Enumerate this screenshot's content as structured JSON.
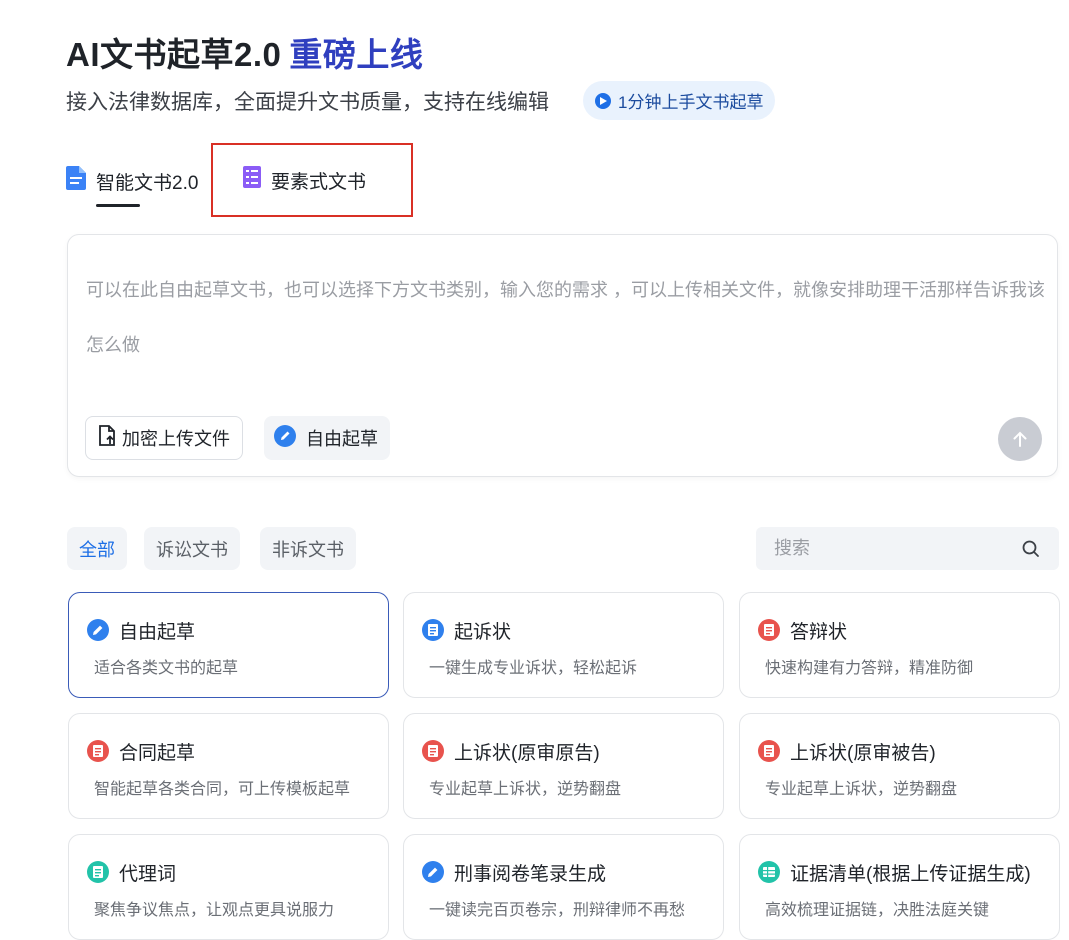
{
  "header": {
    "title": "AI文书起草2.0",
    "title_accent": "重磅上线",
    "subtitle": "接入法律数据库，全面提升文书质量，支持在线编辑",
    "guide_label": "1分钟上手文书起草"
  },
  "tabs": [
    {
      "label": "智能文书2.0",
      "active": true
    },
    {
      "label": "要素式文书",
      "active": false
    }
  ],
  "editor": {
    "placeholder": "可以在此自由起草文书，也可以选择下方文书类别，输入您的需求 ，可以上传相关文件，就像安排助理干活那样告诉我该怎么做",
    "upload_label": "加密上传文件",
    "free_draft_label": "自由起草"
  },
  "filters": {
    "all": "全部",
    "litigation": "诉讼文书",
    "non_litigation": "非诉文书"
  },
  "search": {
    "placeholder": "搜索"
  },
  "cards": [
    {
      "title": "自由起草",
      "desc": "适合各类文书的起草",
      "icon": "pen-icon",
      "color": "#2f80ed",
      "selected": true
    },
    {
      "title": "起诉状",
      "desc": "一键生成专业诉状，轻松起诉",
      "icon": "document-icon",
      "color": "#2f80ed"
    },
    {
      "title": "答辩状",
      "desc": "快速构建有力答辩，精准防御",
      "icon": "document-icon",
      "color": "#e8534d"
    },
    {
      "title": "合同起草",
      "desc": "智能起草各类合同，可上传模板起草",
      "icon": "document-icon",
      "color": "#e8534d"
    },
    {
      "title": "上诉状(原审原告)",
      "desc": "专业起草上诉状，逆势翻盘",
      "icon": "document-icon",
      "color": "#e8534d"
    },
    {
      "title": "上诉状(原审被告)",
      "desc": "专业起草上诉状，逆势翻盘",
      "icon": "document-icon",
      "color": "#e8534d"
    },
    {
      "title": "代理词",
      "desc": "聚焦争议焦点，让观点更具说服力",
      "icon": "document-icon",
      "color": "#22c3a9"
    },
    {
      "title": "刑事阅卷笔录生成",
      "desc": "一键读完百页卷宗，刑辩律师不再愁",
      "icon": "pen-icon",
      "color": "#2f80ed"
    },
    {
      "title": "证据清单(根据上传证据生成)",
      "desc": "高效梳理证据链，决胜法庭关键",
      "icon": "table-icon",
      "color": "#22c3a9"
    }
  ]
}
